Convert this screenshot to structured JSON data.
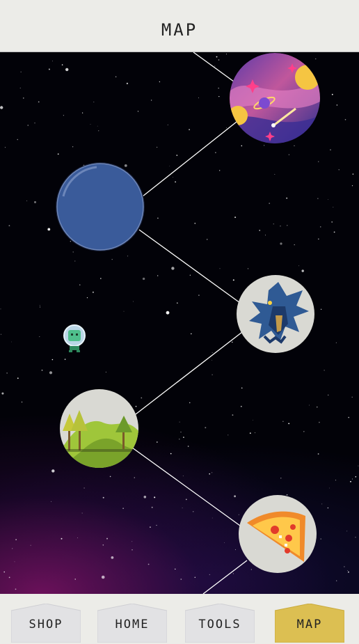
{
  "header": {
    "title": "MAP"
  },
  "nav": {
    "tabs": [
      {
        "label": "SHOP",
        "active": false
      },
      {
        "label": "HOME",
        "active": false
      },
      {
        "label": "TOOLS",
        "active": false
      },
      {
        "label": "MAP",
        "active": true
      }
    ]
  },
  "map": {
    "nodes": [
      {
        "name": "galaxy-level-node",
        "icon": "nebula-planet-icon"
      },
      {
        "name": "blue-planet-node",
        "icon": "blue-planet-icon"
      },
      {
        "name": "dragon-level-node",
        "icon": "dragon-icon"
      },
      {
        "name": "forest-level-node",
        "icon": "forest-mountain-icon"
      },
      {
        "name": "pizza-level-node",
        "icon": "pizza-slice-icon"
      }
    ],
    "player": "astronaut-icon"
  },
  "colors": {
    "header_bg": "#ecece8",
    "tab_bg": "#e2e2e4",
    "tab_active_bg": "#dcbf52",
    "blue_planet": "#3a5b9a",
    "node_bg": "#d9d9d3"
  }
}
